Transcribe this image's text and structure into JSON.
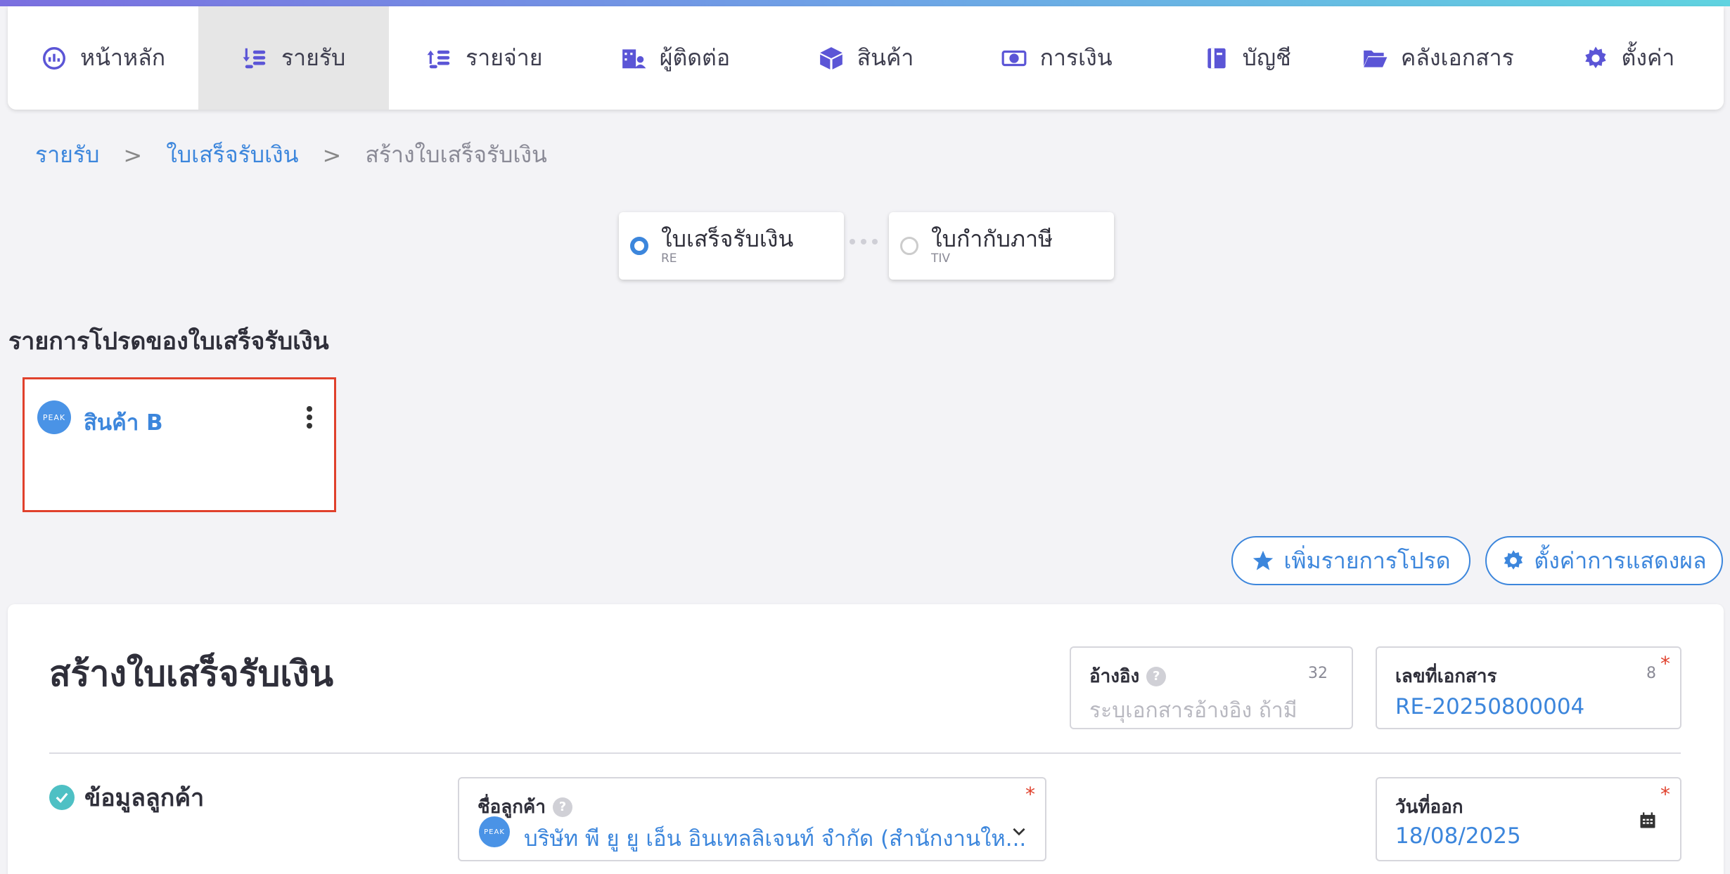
{
  "nav": {
    "items": [
      {
        "label": "หน้าหลัก",
        "icon": "dashboard-icon"
      },
      {
        "label": "รายรับ",
        "icon": "income-icon"
      },
      {
        "label": "รายจ่าย",
        "icon": "expense-icon"
      },
      {
        "label": "ผู้ติดต่อ",
        "icon": "contacts-icon"
      },
      {
        "label": "สินค้า",
        "icon": "box-icon"
      },
      {
        "label": "การเงิน",
        "icon": "money-icon"
      },
      {
        "label": "บัญชี",
        "icon": "book-icon"
      },
      {
        "label": "คลังเอกสาร",
        "icon": "folder-icon"
      },
      {
        "label": "ตั้งค่า",
        "icon": "gear-icon"
      }
    ],
    "active": "รายรับ"
  },
  "breadcrumb": {
    "items": [
      "รายรับ",
      "ใบเสร็จรับเงิน",
      "สร้างใบเสร็จรับเงิน"
    ],
    "separator": ">"
  },
  "workflow": [
    {
      "title": "ใบเสร็จรับเงิน",
      "code": "RE",
      "selected": true
    },
    {
      "title": "ใบกำกับภาษี",
      "code": "TIV",
      "selected": false
    }
  ],
  "favorites": {
    "title": "รายการโปรดของใบเสร็จรับเงิน",
    "items": [
      {
        "name": "สินค้า B",
        "logo_text": "PEAK"
      }
    ]
  },
  "actions": {
    "add_favorite": "เพิ่มรายการโปรด",
    "display_settings": "ตั้งค่าการแสดงผล"
  },
  "form": {
    "title": "สร้างใบเสร็จรับเงิน",
    "reference": {
      "label": "อ้างอิง",
      "count": "32",
      "placeholder": "ระบุเอกสารอ้างอิง ถ้ามี"
    },
    "doc_number": {
      "label": "เลขที่เอกสาร",
      "count": "8",
      "value": "RE-20250800004",
      "required": "*"
    },
    "customer_section": "ข้อมูลลูกค้า",
    "customer_name": {
      "label": "ชื่อลูกค้า",
      "value": "บริษัท พี ยู ยู เอ็น อินเทลลิเจนท์ จำกัด (สำนักงานให...",
      "logo_text": "PEAK",
      "required": "*"
    },
    "issue_date": {
      "label": "วันที่ออก",
      "value": "18/08/2025",
      "required": "*"
    }
  },
  "colors": {
    "accent": "#3c86dc",
    "highlight_border": "#e0412c",
    "check": "#4ec0c4"
  }
}
